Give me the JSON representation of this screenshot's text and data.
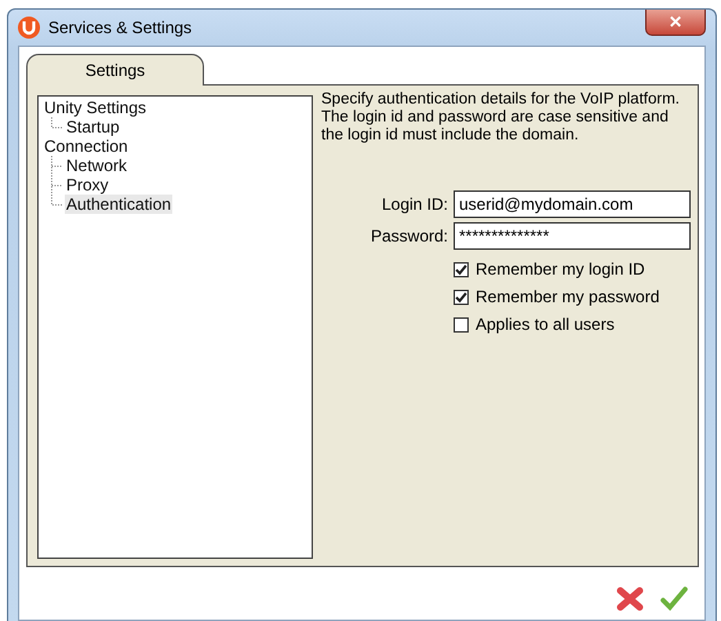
{
  "window": {
    "title": "Services & Settings",
    "close": "✕"
  },
  "tabs": [
    {
      "label": "Settings",
      "selected": true
    }
  ],
  "tree": [
    {
      "label": "Unity Settings",
      "selected": false,
      "children": [
        {
          "label": "Startup",
          "selected": false
        }
      ]
    },
    {
      "label": "Connection",
      "selected": false,
      "children": [
        {
          "label": "Network",
          "selected": false
        },
        {
          "label": "Proxy",
          "selected": false
        },
        {
          "label": "Authentication",
          "selected": true
        }
      ]
    }
  ],
  "description": "Specify authentication details for the VoIP platform. The login id and password are case sensitive and the login id must include the domain.",
  "fields": [
    {
      "label": "Login ID:",
      "value": "userid@mydomain.com"
    },
    {
      "label": "Password:",
      "value": "**************"
    }
  ],
  "checkboxes": [
    {
      "label": "Remember my login ID",
      "checked": true
    },
    {
      "label": "Remember my password",
      "checked": true
    },
    {
      "label": "Applies to all users",
      "checked": false
    }
  ]
}
